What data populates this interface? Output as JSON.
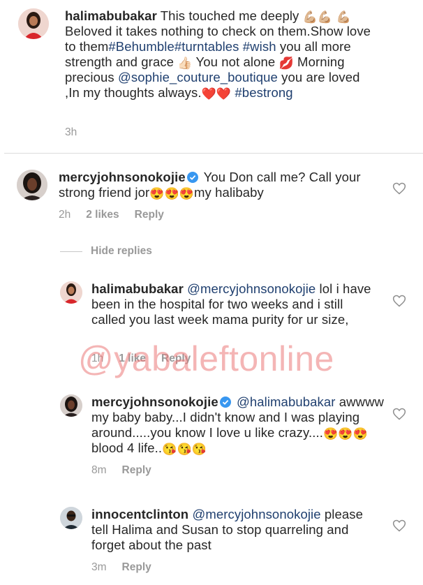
{
  "posts": [
    {
      "username": "halimabubakar",
      "segments": [
        " This touched me deeply ",
        "💪🏼💪🏼",
        " ",
        "💪🏼",
        "Beloved it takes nothing to check on them.Show love to them",
        "#Behumble#turntables",
        " ",
        "#wish",
        " you all more strength and grace ",
        "👍🏻",
        " You not alone ",
        "💋",
        " Morning precious ",
        "@sophie_couture_boutique",
        " you are loved ,In my thoughts always.",
        "❤️❤️",
        " ",
        "#bestrong"
      ],
      "time": "3h"
    },
    {
      "username": "mercyjohnsonokojie",
      "segments": [
        " You Don call me? Call your strong friend jor",
        "😍😍😍",
        "my halibaby"
      ],
      "time": "2h",
      "likes": "2 likes",
      "reply": "Reply"
    },
    {
      "username": "halimabubakar",
      "segments": [
        " ",
        "@mercyjohnsonokojie",
        " lol i have been in the hospital for two weeks and i still called you last week mama purity for ur size,"
      ],
      "time": "1h",
      "likes": "1 like",
      "reply": "Reply"
    },
    {
      "username": "mercyjohnsonokojie",
      "segments": [
        " ",
        "@halimabubakar",
        " awwww my baby baby...I didn't know and I was playing around.....you know I love u like crazy....",
        "😍😍😍",
        "blood 4 life..",
        "😘😘😘"
      ],
      "time": "8m",
      "reply": "Reply"
    },
    {
      "username": "innocentclinton",
      "segments": [
        " ",
        "@mercyjohnsonokojie",
        " please tell Halima and Susan to stop quarreling and forget about the past"
      ],
      "time": "3m",
      "reply": "Reply"
    }
  ],
  "hide_replies": "Hide replies",
  "watermark": "@yabaleftonline",
  "colors": {
    "text": "#262626",
    "link": "#1f3f6f",
    "meta": "#999999",
    "verified": "#3897f0",
    "watermark": "#eb7878"
  },
  "icons": [
    "heart-outline-icon",
    "verified-badge-icon"
  ]
}
